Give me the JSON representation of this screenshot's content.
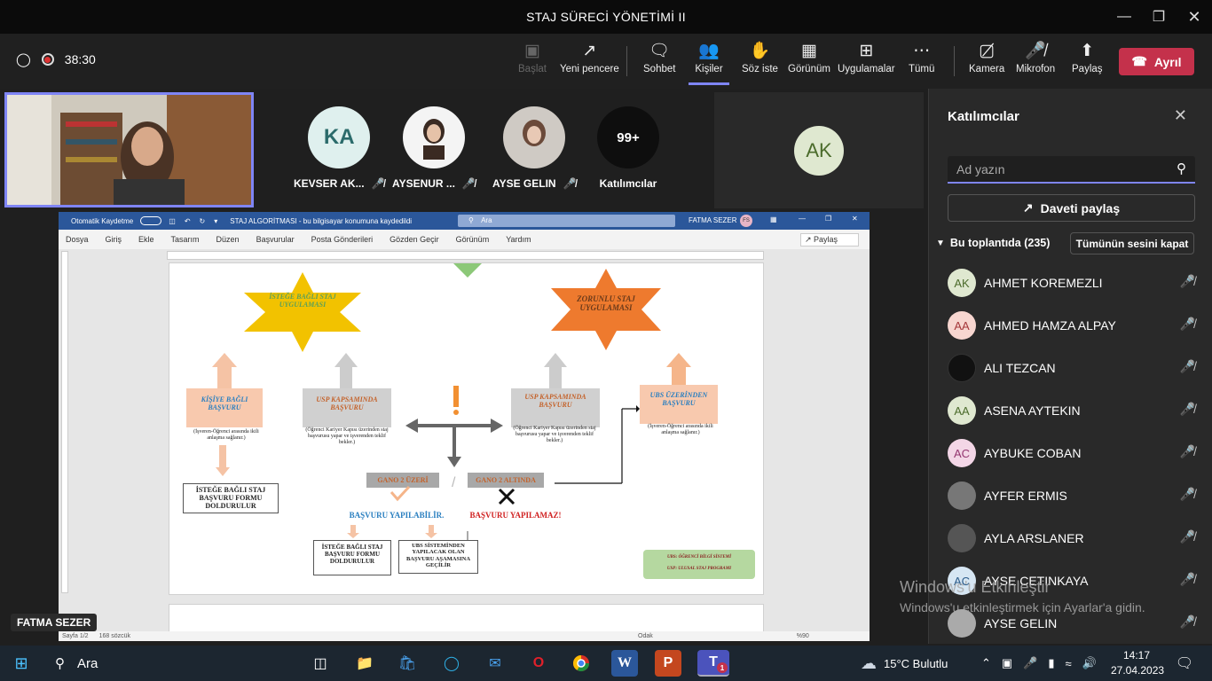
{
  "window": {
    "title": "STAJ SÜRECİ YÖNETİMİ II"
  },
  "toolbar": {
    "timer": "38:30",
    "buttons": [
      {
        "label": "Başlat",
        "icon": "screen-icon"
      },
      {
        "label": "Yeni pencere",
        "icon": "popout-icon"
      },
      {
        "label": "Sohbet",
        "icon": "chat-icon"
      },
      {
        "label": "Kişiler",
        "icon": "people-icon"
      },
      {
        "label": "Söz iste",
        "icon": "hand-icon"
      },
      {
        "label": "Görünüm",
        "icon": "grid-icon"
      },
      {
        "label": "Uygulamalar",
        "icon": "plus-icon"
      },
      {
        "label": "Tümü",
        "icon": "more-icon"
      },
      {
        "label": "Kamera",
        "icon": "camera-off-icon"
      },
      {
        "label": "Mikrofon",
        "icon": "mic-off-icon"
      },
      {
        "label": "Paylaş",
        "icon": "share-icon"
      }
    ],
    "leave_label": "Ayrıl"
  },
  "tiles": [
    {
      "name": "KEVSER AK...",
      "initials": "KA"
    },
    {
      "name": "AYSENUR ...",
      "initials": ""
    },
    {
      "name": "AYSE GELIN",
      "initials": ""
    },
    {
      "name": "Katılımcılar",
      "initials": "99+"
    }
  ],
  "ak_tile": {
    "initials": "AK"
  },
  "presenter": {
    "name": "FATMA SEZER"
  },
  "word": {
    "autosave": "Otomatik Kaydetme",
    "doc_title": "STAJ ALGORİTMASI  -  bu bilgisayar konumuna kaydedildi",
    "search": "Ara",
    "user": "FATMA SEZER",
    "user_initials": "FS",
    "menu": [
      "Dosya",
      "Giriş",
      "Ekle",
      "Tasarım",
      "Düzen",
      "Başvurular",
      "Posta Gönderileri",
      "Gözden Geçir",
      "Görünüm",
      "Yardım"
    ],
    "share": "Paylaş",
    "status_page": "Sayfa 1/2",
    "status_words": "168 sözcük",
    "status_focus": "Odak",
    "zoom": "%90",
    "diagram": {
      "star1": "İSTEĞE BAĞLI STAJ UYGULAMASI",
      "star2": "ZORUNLU STAJ UYGULAMASI",
      "box1": "KİŞİYE BAĞLI BAŞVURU",
      "box2": "USP KAPSAMINDA BAŞVURU",
      "box3": "USP KAPSAMINDA BAŞVURU",
      "box4": "UBS ÜZERİNDEN BAŞVURU",
      "note1": "(İşveren-Öğrenci arasında ikili anlaşma sağlanır.)",
      "note2": "(Öğrenci Kariyer Kapısı üzerinden staj başvurusu yapar ve işverenden teklif bekler.)",
      "note3": "(Öğrenci Kariyer Kapısı üzerinden staj başvurusu yapar ve işverenden teklif bekler.)",
      "note4": "(İşveren-Öğrenci arasında ikili anlaşma sağlanır.)",
      "form1": "İSTEĞE BAĞLI STAJ BAŞVURU FORMU DOLDURULUR",
      "gano_up": "GANO 2 ÜZERİ",
      "gano_down": "GANO 2 ALTINDA",
      "yes": "BAŞVURU YAPILABİLİR.",
      "no": "BAŞVURU YAPILAMAZ!",
      "form2": "İSTEĞE BAĞLI STAJ BAŞVURU FORMU DOLDURULUR",
      "ubs_step": "UBS SİSTEMİNDEN YAPILACAK OLAN BAŞVURU AŞAMASINA GEÇİLİR",
      "legend1": "UBS: ÖĞRENCİ BİLGİ SİSTEMİ",
      "legend2": "USP: ULUSAL STAJ PROGRAMI"
    }
  },
  "panel": {
    "title": "Katılımcılar",
    "search_placeholder": "Ad yazın",
    "invite_label": "Daveti paylaş",
    "section_label": "Bu toplantıda (235)",
    "mute_all": "Tümünün sesini kapat",
    "participants": [
      {
        "name": "AHMET KOREMEZLI",
        "initials": "AK",
        "color": "#dfe8d0",
        "fg": "#4b6b2b"
      },
      {
        "name": "AHMED HAMZA ALPAY",
        "initials": "AA",
        "color": "#f7d6d0",
        "fg": "#a4373a"
      },
      {
        "name": "ALI TEZCAN",
        "initials": "",
        "color": "#111111",
        "fg": "#ffffff"
      },
      {
        "name": "ASENA AYTEKIN",
        "initials": "AA",
        "color": "#dfe8d0",
        "fg": "#4b6b2b"
      },
      {
        "name": "AYBUKE COBAN",
        "initials": "AC",
        "color": "#f3d6e6",
        "fg": "#943670"
      },
      {
        "name": "AYFER ERMIS",
        "initials": "",
        "color": "#777777",
        "fg": "#ffffff"
      },
      {
        "name": "AYLA ARSLANER",
        "initials": "",
        "color": "#555555",
        "fg": "#ffffff"
      },
      {
        "name": "AYSE CETINKAYA",
        "initials": "AC",
        "color": "#d6e6f3",
        "fg": "#2b5b8a"
      },
      {
        "name": "AYSE GELIN",
        "initials": "",
        "color": "#aaaaaa",
        "fg": "#ffffff"
      }
    ]
  },
  "activation": {
    "line1": "Windows'u Etkinleştir",
    "line2": "Windows'u etkinleştirmek için Ayarlar'a gidin."
  },
  "taskbar": {
    "search": "Ara",
    "weather": "15°C  Bulutlu",
    "time": "14:17",
    "date": "27.04.2023",
    "teams_badge": "1"
  }
}
